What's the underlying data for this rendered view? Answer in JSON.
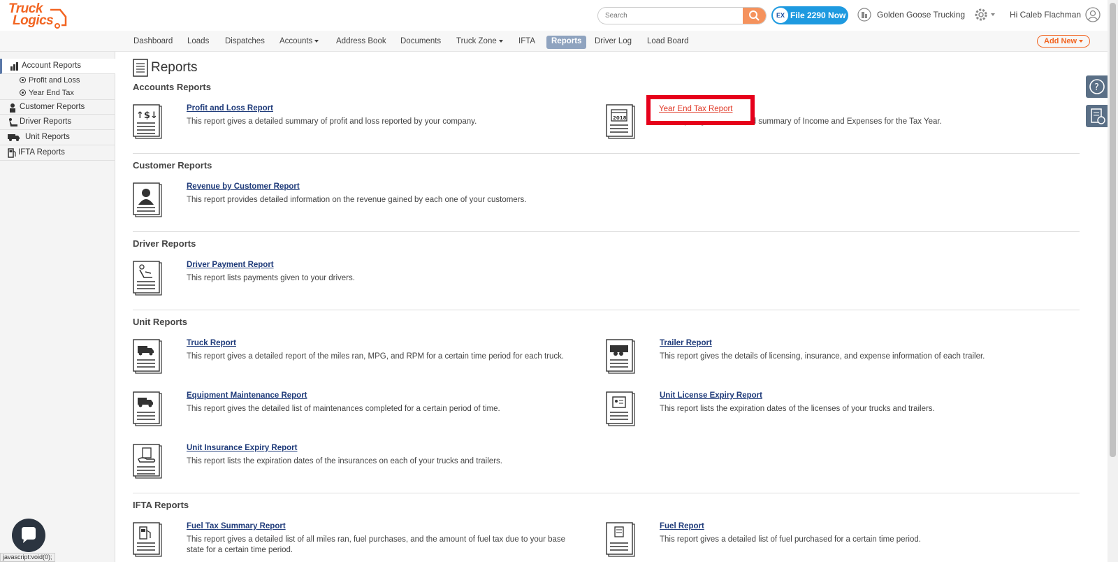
{
  "brand": {
    "line1": "Truck",
    "line2": "Logics",
    "color": "#f26522"
  },
  "header": {
    "search_placeholder": "Search",
    "file_badge": "EX",
    "file_button": "File 2290 Now",
    "company": "Golden Goose Trucking",
    "greeting": "Hi Caleb Flachman"
  },
  "nav": {
    "items": [
      {
        "label": "Dashboard"
      },
      {
        "label": "Loads"
      },
      {
        "label": "Dispatches"
      },
      {
        "label": "Accounts"
      },
      {
        "label": "Address Book"
      },
      {
        "label": "Documents"
      },
      {
        "label": "Truck Zone"
      },
      {
        "label": "IFTA"
      },
      {
        "label": "Reports"
      },
      {
        "label": "Driver Log"
      },
      {
        "label": "Load Board"
      }
    ],
    "active": "Reports",
    "add_new": "Add New"
  },
  "sidebar": {
    "account_reports": "Account Reports",
    "profit_and_loss": "Profit and Loss",
    "year_end_tax": "Year End Tax",
    "customer_reports": "Customer Reports",
    "driver_reports": "Driver Reports",
    "unit_reports": "Unit Reports",
    "ifta_reports": "IFTA Reports"
  },
  "main": {
    "title": "Reports",
    "sections": {
      "accounts": "Accounts Reports",
      "customer": "Customer Reports",
      "driver": "Driver Reports",
      "unit": "Unit Reports",
      "ifta": "IFTA Reports"
    },
    "reports": {
      "pnl": {
        "name": "Profit and Loss Report",
        "desc": "This report gives a detailed summary of profit and loss reported by your company."
      },
      "yet": {
        "name": "Year End Tax Report",
        "desc": "This report gives a detailed summary of Income and Expenses for the Tax Year."
      },
      "rev": {
        "name": "Revenue by Customer Report",
        "desc": "This report provides detailed information on the revenue gained by each one of your customers."
      },
      "drv": {
        "name": "Driver Payment Report",
        "desc": "This report lists payments given to your drivers."
      },
      "truck": {
        "name": "Truck Report",
        "desc": "This report gives a detailed report of the miles ran, MPG, and RPM for a certain time period for each truck."
      },
      "trailer": {
        "name": "Trailer Report",
        "desc": "This report gives the details of licensing, insurance, and expense information of each trailer."
      },
      "equip": {
        "name": "Equipment Maintenance Report",
        "desc": "This report gives the detailed list of maintenances completed for a certain period of time."
      },
      "license": {
        "name": "Unit License Expiry Report",
        "desc": "This report lists the expiration dates of the licenses of your trucks and trailers."
      },
      "insurance": {
        "name": "Unit Insurance Expiry Report",
        "desc": "This report lists the expiration dates of the insurances on each of your trucks and trailers."
      },
      "fueltax": {
        "name": "Fuel Tax Summary Report",
        "desc": "This report gives a detailed list of all miles ran, fuel purchases, and the amount of fuel tax due to your base state for a certain time period."
      },
      "fuel": {
        "name": "Fuel Report",
        "desc": "This report gives a detailed list of fuel purchased for a certain time period."
      }
    },
    "year_badge": "2018"
  },
  "statusbar": "javascript:void(0);",
  "colors": {
    "highlight": "#e6001b",
    "nav_active": "#8fa3bf",
    "file_button": "#1e9ae0"
  }
}
